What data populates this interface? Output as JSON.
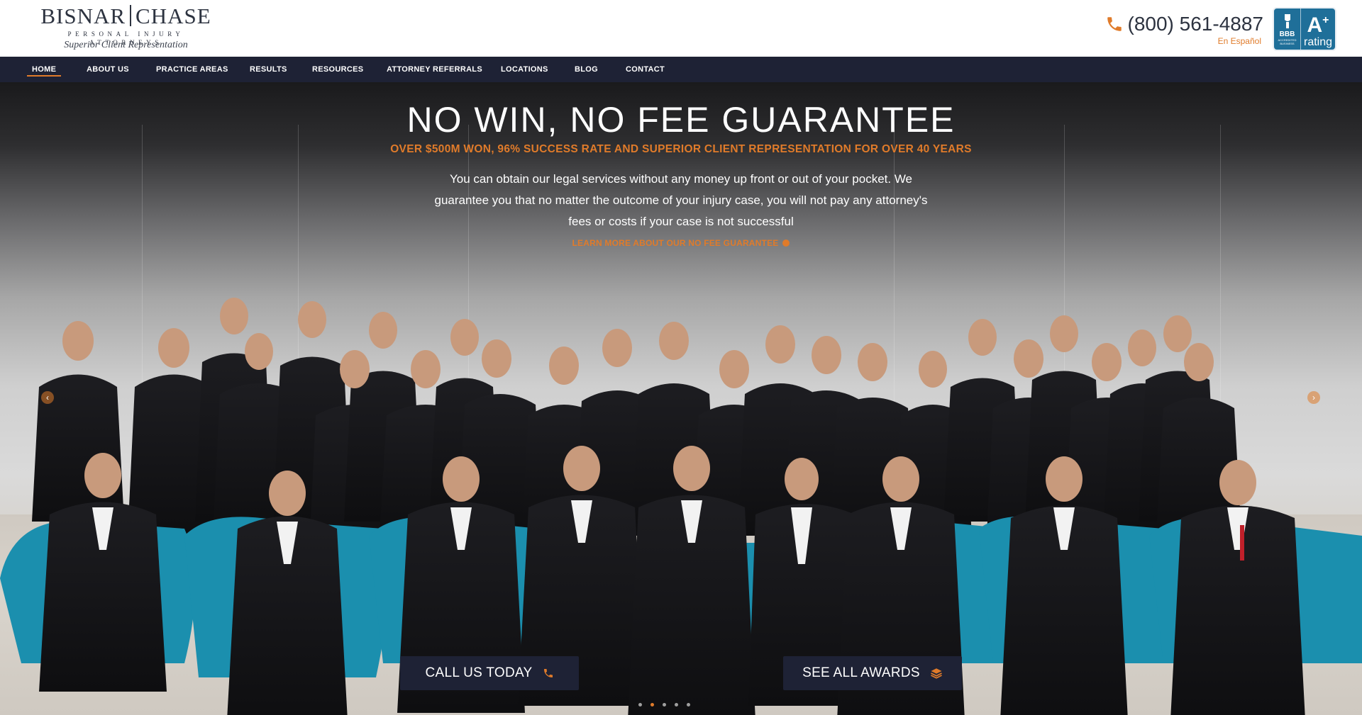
{
  "header": {
    "logo": {
      "name_left": "BISNAR",
      "name_right": "CHASE",
      "subtitle": "PERSONAL INJURY ATTORNEYS",
      "tagline": "Superior Client Representation"
    },
    "phone": "(800) 561-4887",
    "language_link": "En Español",
    "bbb": {
      "word": "BBB",
      "small": "ACCREDITED BUSINESS",
      "grade": "A",
      "grade_sup": "+",
      "rating": "rating"
    }
  },
  "nav": {
    "items": [
      {
        "label": "HOME",
        "active": true
      },
      {
        "label": "ABOUT US"
      },
      {
        "label": "PRACTICE AREAS"
      },
      {
        "label": "RESULTS"
      },
      {
        "label": "RESOURCES"
      },
      {
        "label": "ATTORNEY REFERRALS"
      },
      {
        "label": "LOCATIONS"
      },
      {
        "label": "BLOG"
      },
      {
        "label": "CONTACT"
      }
    ]
  },
  "hero": {
    "title": "NO WIN, NO FEE GUARANTEE",
    "subtitle": "OVER $500M WON, 96% SUCCESS RATE AND SUPERIOR CLIENT REPRESENTATION FOR OVER 40 YEARS",
    "body": "You can obtain our legal services without any money up front or out of your pocket. We guarantee you that no matter the outcome of your injury case, you will not pay any attorney's fees or costs if your case is not successful",
    "link": "LEARN MORE ABOUT OUR NO FEE GUARANTEE",
    "cta_call": "CALL US TODAY",
    "cta_awards": "SEE ALL AWARDS",
    "slides": {
      "count": 5,
      "active": 1
    }
  },
  "colors": {
    "accent": "#e07b2a",
    "navy": "#1e2235",
    "chair": "#1b8fae",
    "bbb_blue": "#1f6f99"
  },
  "icons": [
    "phone-icon",
    "bbb-torch-icon",
    "arrow-left-icon",
    "arrow-right-icon",
    "layers-icon",
    "circle-arrow-icon"
  ]
}
